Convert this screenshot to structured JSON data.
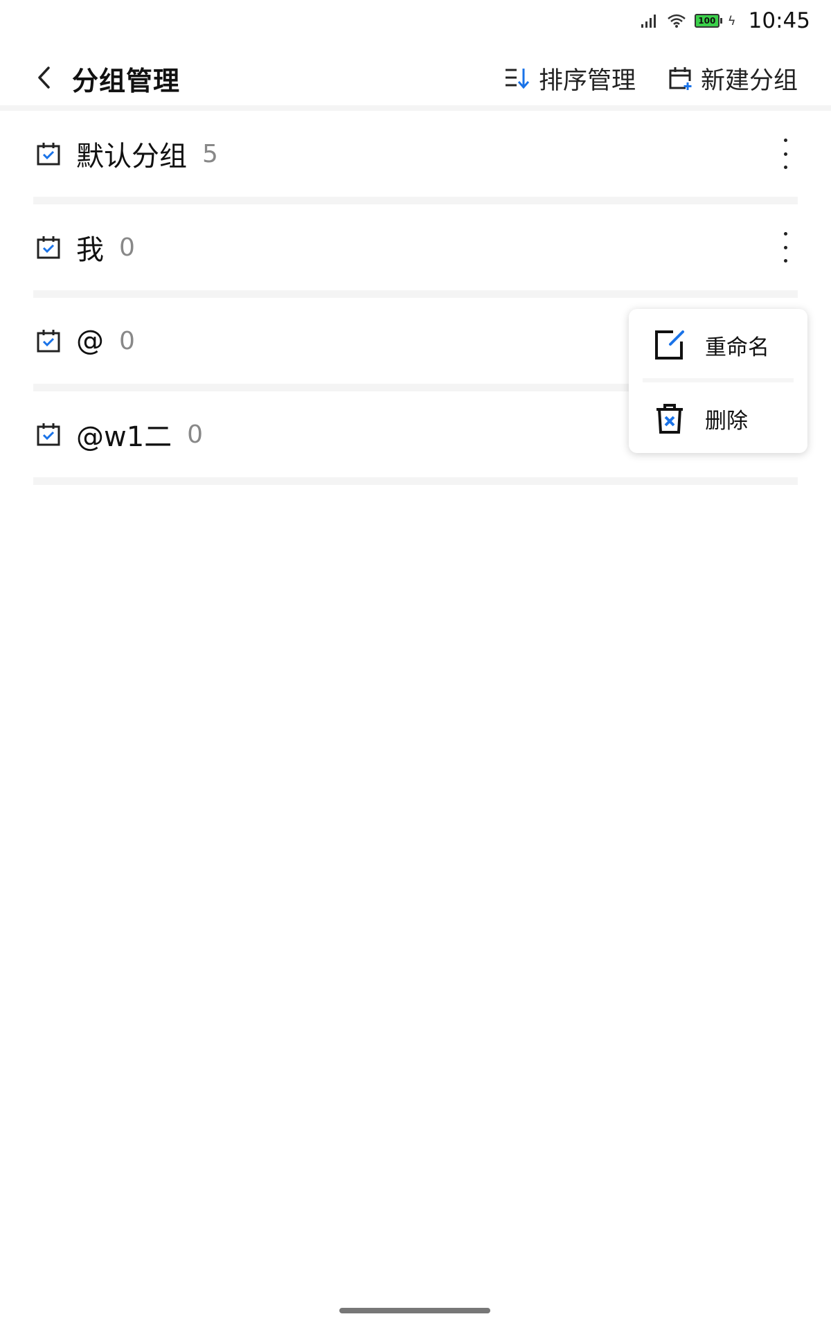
{
  "status_bar": {
    "time": "10:45",
    "battery_level": "100",
    "icons": [
      "signal-icon",
      "wifi-icon",
      "battery-icon",
      "charging-icon"
    ]
  },
  "header": {
    "title": "分组管理",
    "sort_label": "排序管理",
    "new_group_label": "新建分组"
  },
  "groups": [
    {
      "name": "默认分组",
      "count": "5"
    },
    {
      "name": "我",
      "count": "0"
    },
    {
      "name": "@",
      "count": "0"
    },
    {
      "name": "@w1二",
      "count": "0"
    }
  ],
  "context_menu": {
    "rename_label": "重命名",
    "delete_label": "删除"
  },
  "colors": {
    "accent": "#1a73e8",
    "text_primary": "#111111",
    "text_count": "#888888",
    "divider": "#f4f4f4"
  }
}
